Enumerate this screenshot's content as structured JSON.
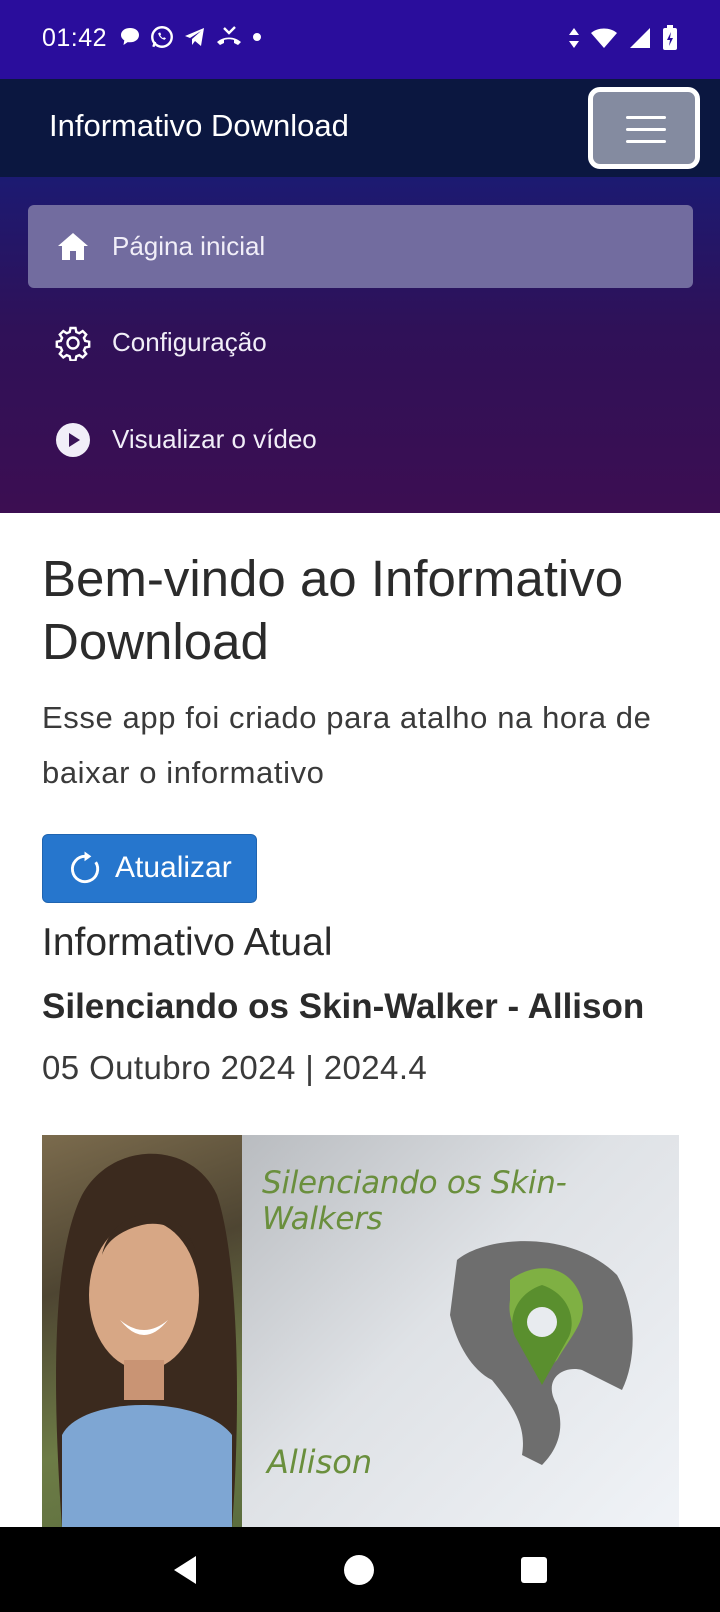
{
  "status_bar": {
    "time": "01:42",
    "notification_icons": [
      "chat-bubble-icon",
      "whatsapp-icon",
      "telegram-icon",
      "missed-call-icon",
      "dot-icon"
    ],
    "system_icons": [
      "data-arrows-icon",
      "wifi-icon",
      "signal-icon",
      "battery-icon"
    ]
  },
  "navbar": {
    "brand": "Informativo Download",
    "toggler_icon": "hamburger-icon"
  },
  "nav_menu": {
    "items": [
      {
        "label": "Página inicial",
        "icon": "home-icon",
        "active": true
      },
      {
        "label": "Configuração",
        "icon": "gear-icon",
        "active": false
      },
      {
        "label": "Visualizar o vídeo",
        "icon": "play-circle-icon",
        "active": false
      }
    ]
  },
  "main": {
    "title": "Bem-vindo ao Informativo Download",
    "lead": "Esse app foi criado para atalho na hora de baixar o informativo",
    "refresh_button": {
      "label": "Atualizar",
      "icon": "refresh-icon"
    },
    "section_title": "Informativo Atual",
    "item_title": "Silenciando os Skin-Walker - Allison",
    "item_date": "05 Outubro 2024 | 2024.4",
    "banner": {
      "title": "Silenciando os Skin-Walkers",
      "name": "Allison"
    }
  },
  "system_nav": {
    "buttons": [
      "back-icon",
      "home-circle-icon",
      "recents-icon"
    ]
  },
  "colors": {
    "status_bar": "#2a0d9c",
    "navbar": "#0b1740",
    "active_item": "#726c9f",
    "button": "#2676cd",
    "banner_green": "#6a8f3d"
  }
}
